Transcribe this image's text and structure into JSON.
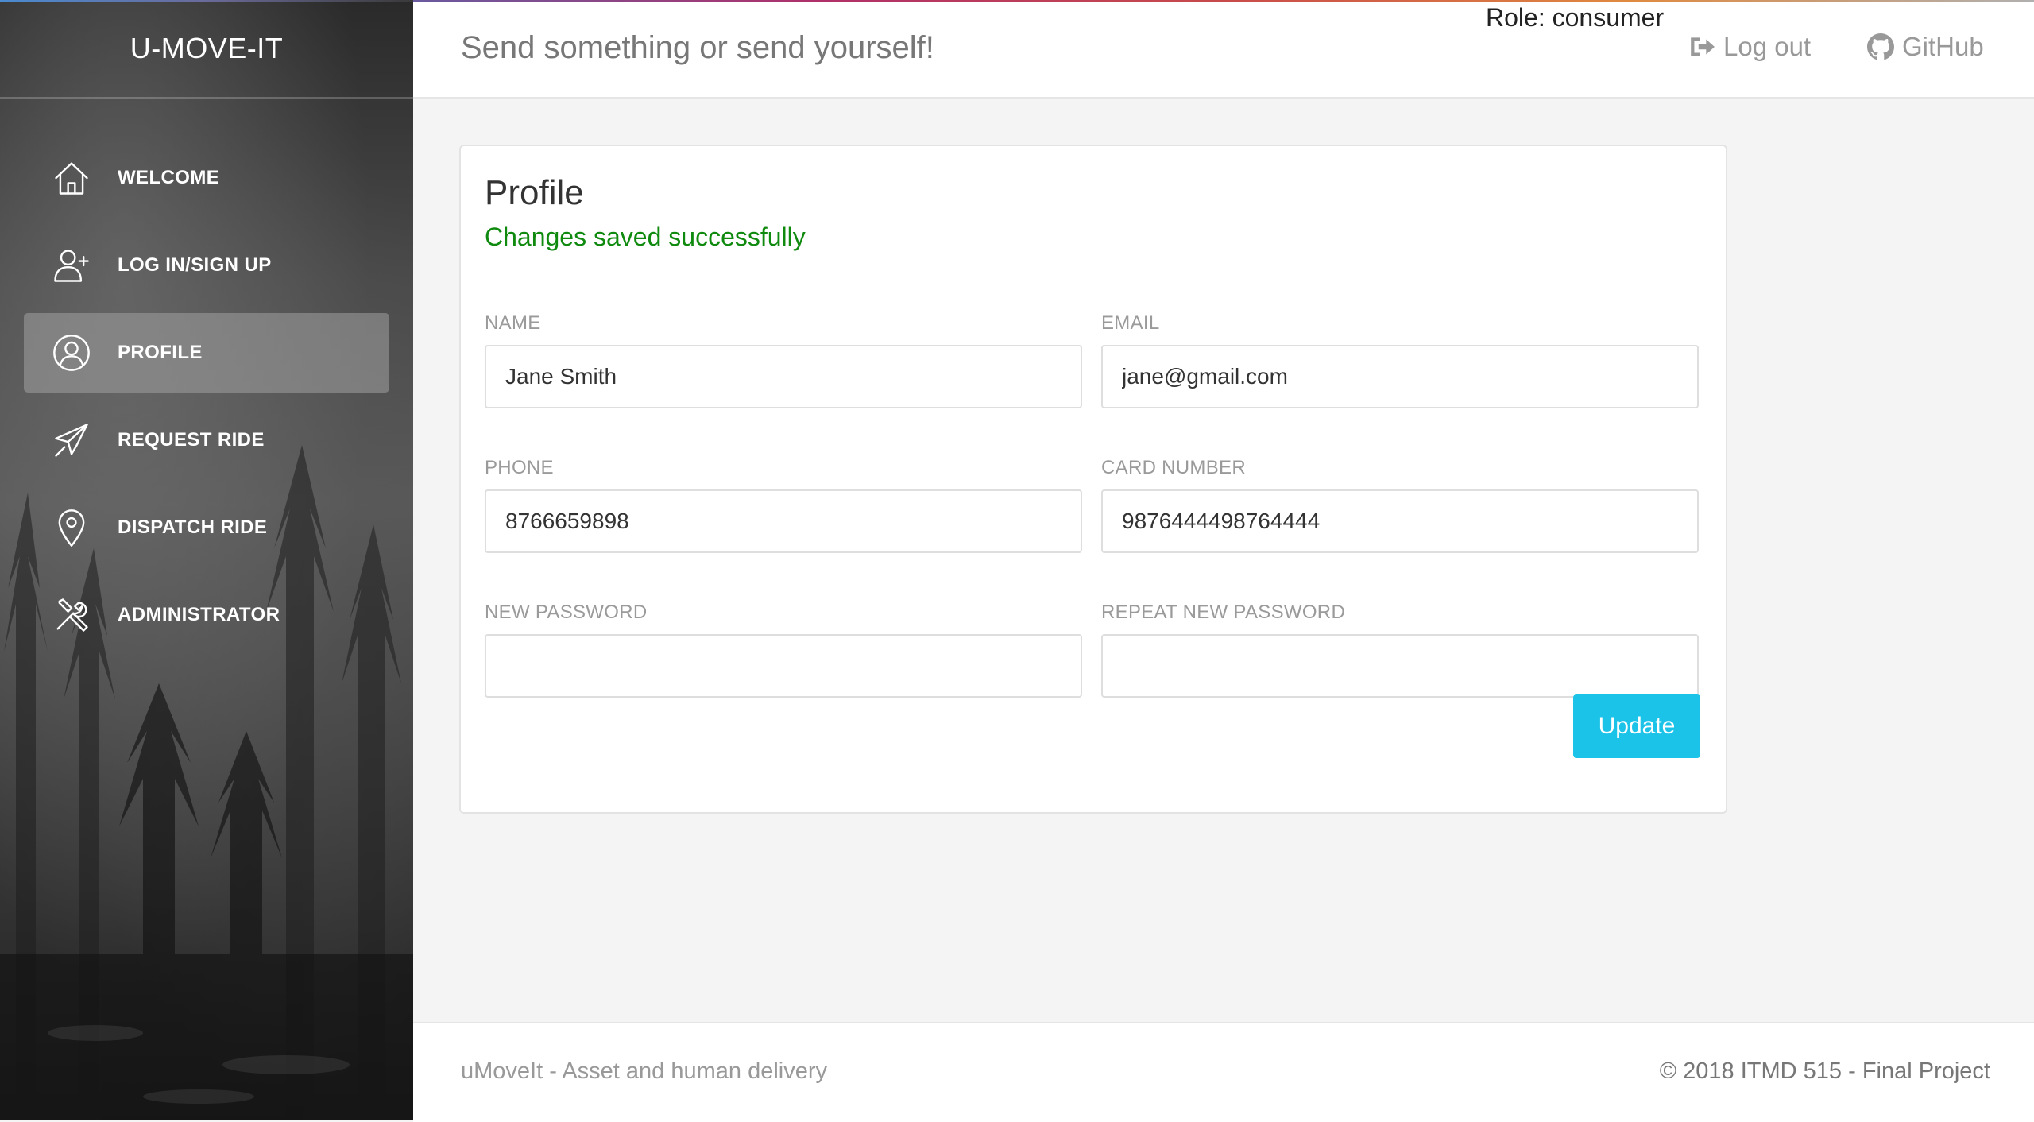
{
  "sidebar": {
    "brand": "U-MOVE-IT",
    "items": [
      {
        "label": "WELCOME",
        "icon": "home-icon",
        "active": false
      },
      {
        "label": "LOG IN/SIGN UP",
        "icon": "add-user-icon",
        "active": false
      },
      {
        "label": "PROFILE",
        "icon": "user-circle-icon",
        "active": true
      },
      {
        "label": "REQUEST RIDE",
        "icon": "airplane-icon",
        "active": false
      },
      {
        "label": "DISPATCH RIDE",
        "icon": "map-pin-icon",
        "active": false
      },
      {
        "label": "ADMINISTRATOR",
        "icon": "tools-icon",
        "active": false
      }
    ]
  },
  "header": {
    "tagline": "Send something or send yourself!",
    "role": "Role: consumer",
    "logout_label": "Log out",
    "logout_icon": "sign-out-icon",
    "github_label": "GitHub",
    "github_icon": "github-icon"
  },
  "profile": {
    "title": "Profile",
    "message": "Changes saved successfully",
    "message_color": "#0f8a0f",
    "fields": {
      "name": {
        "label": "NAME",
        "value": "Jane Smith"
      },
      "email": {
        "label": "EMAIL",
        "value": "jane@gmail.com"
      },
      "phone": {
        "label": "PHONE",
        "value": "8766659898"
      },
      "card_number": {
        "label": "CARD NUMBER",
        "value": "9876444498764444"
      },
      "new_password": {
        "label": "NEW PASSWORD",
        "value": ""
      },
      "repeat_password": {
        "label": "REPEAT NEW PASSWORD",
        "value": ""
      }
    },
    "update_label": "Update",
    "accent_color": "#1cc3e8"
  },
  "footer": {
    "left": "uMoveIt - Asset and human delivery",
    "right": "© 2018 ITMD 515 - Final Project"
  }
}
